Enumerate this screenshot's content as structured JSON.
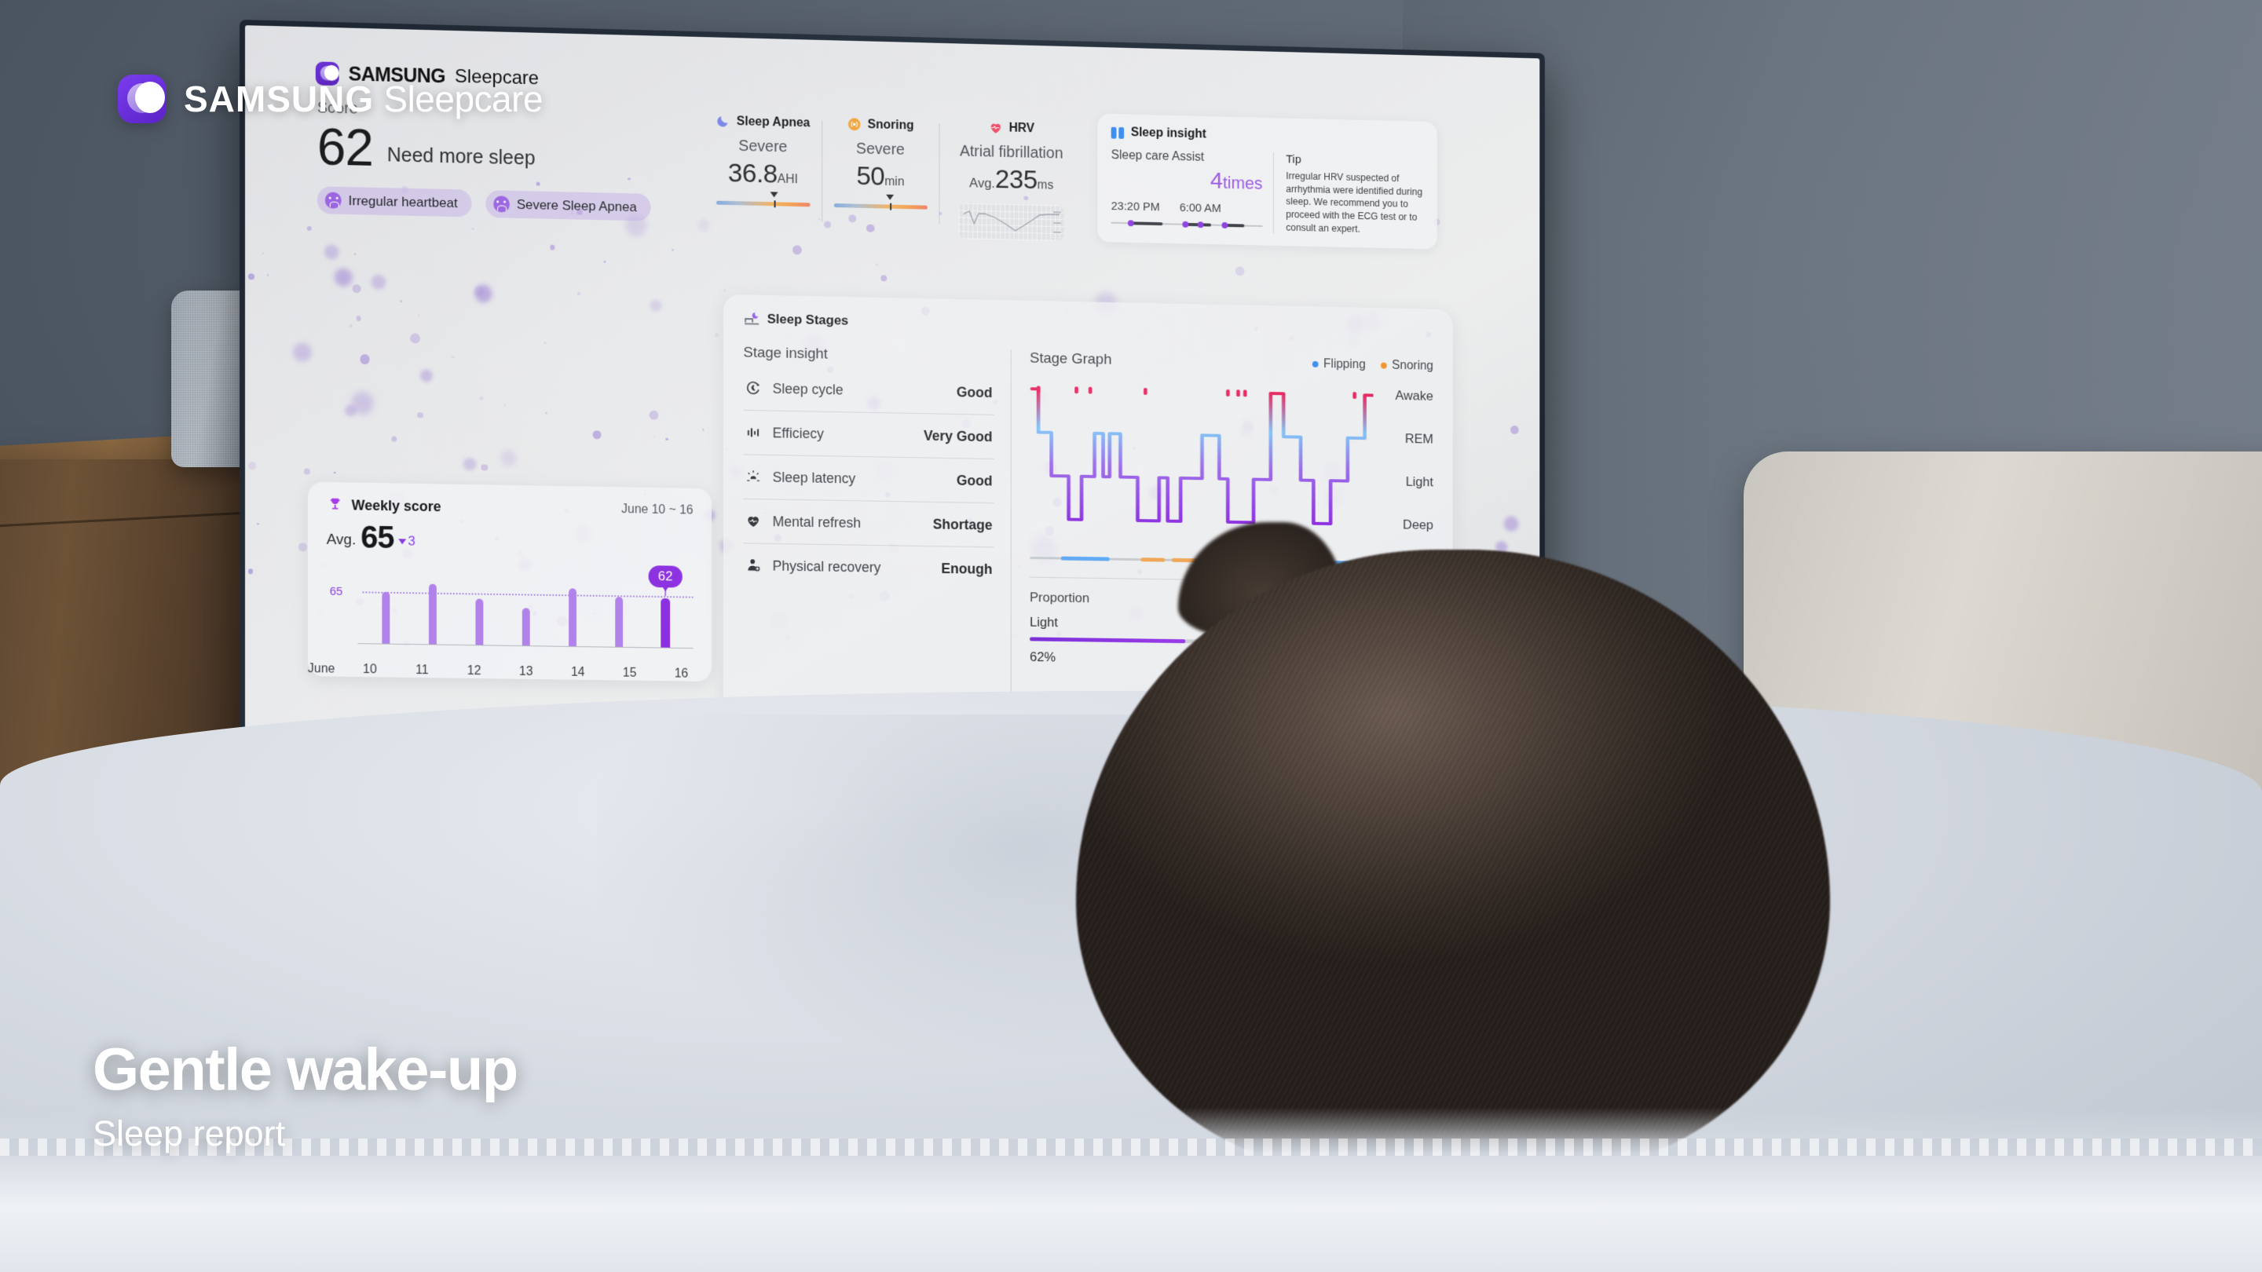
{
  "overlay": {
    "logo_mark": "crescent-moon-logo",
    "brand_bold": "SAMSUNG",
    "brand_light": "Sleepcare",
    "caption_title": "Gentle wake-up",
    "caption_sub": "Sleep report"
  },
  "screen": {
    "brand": {
      "bold": "SAMSUNG",
      "light": "Sleepcare"
    },
    "score": {
      "label": "Score",
      "value": "62",
      "message": "Need more sleep",
      "chips": [
        {
          "label": "Irregular heartbeat",
          "icon": "sad-face-icon"
        },
        {
          "label": "Severe Sleep Apnea",
          "icon": "sad-face-icon"
        }
      ]
    },
    "metrics": [
      {
        "title": "Sleep Apnea",
        "icon": "moon-icon",
        "icon_color": "#7b85e8",
        "severity": "Severe",
        "value": "36.8",
        "unit": "AHI",
        "prefix": "",
        "marker_pct": 62
      },
      {
        "title": "Snoring",
        "icon": "snore-wave-icon",
        "icon_color": "#f2a33c",
        "severity": "Severe",
        "value": "50",
        "unit": "min",
        "prefix": "",
        "marker_pct": 60
      },
      {
        "title": "HRV",
        "icon": "heart-pulse-icon",
        "icon_color": "#ee4a62",
        "severity": "Atrial fibrillation",
        "value": "235",
        "unit": "ms",
        "prefix": "Avg.",
        "marker_pct": null
      }
    ],
    "insight": {
      "title": "Sleep insight",
      "icon": "book-icon",
      "assist_label": "Sleep care Assist",
      "assist_count": "4",
      "assist_unit": "times",
      "time_start": "23:20 PM",
      "time_end": "6:00 AM",
      "tip_title": "Tip",
      "tip_text": "Irregular HRV suspected of arrhythmia were identified during sleep. We recommend you to proceed with the ECG test or to consult an expert."
    },
    "weekly": {
      "title": "Weekly score",
      "icon": "trophy-icon",
      "range": "June 10 ~ 16",
      "avg_label": "Avg.",
      "avg_value": "65",
      "delta": "3",
      "delta_direction": "down",
      "selected_label": "62",
      "month_label": "June",
      "avgline_label": "65"
    },
    "stages": {
      "title": "Sleep Stages",
      "icon": "bed-moon-icon",
      "insight_label": "Stage insight",
      "rows": [
        {
          "name": "Sleep cycle",
          "value": "Good",
          "icon": "sleep-cycle-icon"
        },
        {
          "name": "Efficiecy",
          "value": "Very Good",
          "icon": "bars-icon"
        },
        {
          "name": "Sleep latency",
          "value": "Good",
          "icon": "sunrise-icon"
        },
        {
          "name": "Mental refresh",
          "value": "Shortage",
          "icon": "heart-icon"
        },
        {
          "name": "Physical recovery",
          "value": "Enough",
          "icon": "person-icon"
        }
      ],
      "graph_label": "Stage Graph",
      "legend": [
        {
          "label": "Flipping",
          "color": "#3b8ef0"
        },
        {
          "label": "Snoring",
          "color": "#f0962e"
        }
      ],
      "stage_labels": [
        "Awake",
        "REM",
        "Light",
        "Deep"
      ],
      "proportion_label": "Proportion",
      "proportion_stage": "Light",
      "proportion_pct": "62%",
      "proportion_value": 62
    }
  },
  "chart_data": [
    {
      "type": "bar",
      "title": "Weekly score",
      "categories": [
        "10",
        "11",
        "12",
        "13",
        "14",
        "15",
        "16"
      ],
      "values": [
        65,
        76,
        58,
        47,
        73,
        63,
        62
      ],
      "highlight_index": 6,
      "average": 65,
      "ylim": [
        0,
        100
      ],
      "xlabel": "June",
      "ylabel": "",
      "grid": false,
      "annotations": [
        "62"
      ]
    },
    {
      "type": "line",
      "title": "Stage Graph",
      "ylabel": "",
      "xlabel": "",
      "y_categories": [
        "Awake",
        "REM",
        "Light",
        "Deep"
      ],
      "stage_levels": [
        3,
        2,
        1,
        0
      ],
      "segments": [
        {
          "x": 0.5,
          "stage": "Awake"
        },
        {
          "x": 2.0,
          "stage": "REM"
        },
        {
          "x": 5.0,
          "stage": "Light"
        },
        {
          "x": 9.0,
          "stage": "Deep"
        },
        {
          "x": 12.0,
          "stage": "Light"
        },
        {
          "x": 15.0,
          "stage": "REM"
        },
        {
          "x": 17.0,
          "stage": "Light"
        },
        {
          "x": 18.5,
          "stage": "REM"
        },
        {
          "x": 21.0,
          "stage": "Light"
        },
        {
          "x": 25.0,
          "stage": "Deep"
        },
        {
          "x": 30.0,
          "stage": "Light"
        },
        {
          "x": 32.0,
          "stage": "Deep"
        },
        {
          "x": 35.0,
          "stage": "Light"
        },
        {
          "x": 40.0,
          "stage": "REM"
        },
        {
          "x": 44.0,
          "stage": "Light"
        },
        {
          "x": 46.0,
          "stage": "Deep"
        },
        {
          "x": 52.0,
          "stage": "Light"
        },
        {
          "x": 56.0,
          "stage": "Awake"
        },
        {
          "x": 59.0,
          "stage": "REM"
        },
        {
          "x": 63.0,
          "stage": "Light"
        },
        {
          "x": 66.0,
          "stage": "Deep"
        },
        {
          "x": 70.0,
          "stage": "Light"
        },
        {
          "x": 74.0,
          "stage": "REM"
        },
        {
          "x": 78.0,
          "stage": "Awake"
        }
      ],
      "awake_markers": [
        2,
        13,
        17,
        33,
        57,
        60,
        62,
        94
      ],
      "event_timeline": [
        {
          "type": "Flipping",
          "start": 9,
          "end": 23,
          "color": "#5fa8f5"
        },
        {
          "type": "Snoring",
          "start": 32,
          "end": 39,
          "color": "#f0a655"
        },
        {
          "type": "Snoring",
          "start": 41,
          "end": 49,
          "color": "#f0a655"
        },
        {
          "type": "Snoring",
          "start": 51,
          "end": 57,
          "color": "#f0a655"
        },
        {
          "type": "Flipping",
          "start": 66,
          "end": 77,
          "color": "#5fa8f5"
        },
        {
          "type": "Snoring",
          "start": 78,
          "end": 84,
          "color": "#f0a655"
        },
        {
          "type": "Flipping",
          "start": 88,
          "end": 95,
          "color": "#5fa8f5"
        }
      ],
      "legend": [
        "Flipping",
        "Snoring"
      ],
      "legend_position": "top-right"
    },
    {
      "type": "line",
      "title": "HRV trend",
      "values": [
        72,
        66,
        74,
        38,
        70,
        68,
        62,
        55,
        46,
        38,
        30,
        24,
        20,
        30,
        44,
        58,
        66,
        66
      ],
      "ylim": [
        0,
        100
      ],
      "grid": true,
      "xlabel": "",
      "ylabel": ""
    }
  ]
}
